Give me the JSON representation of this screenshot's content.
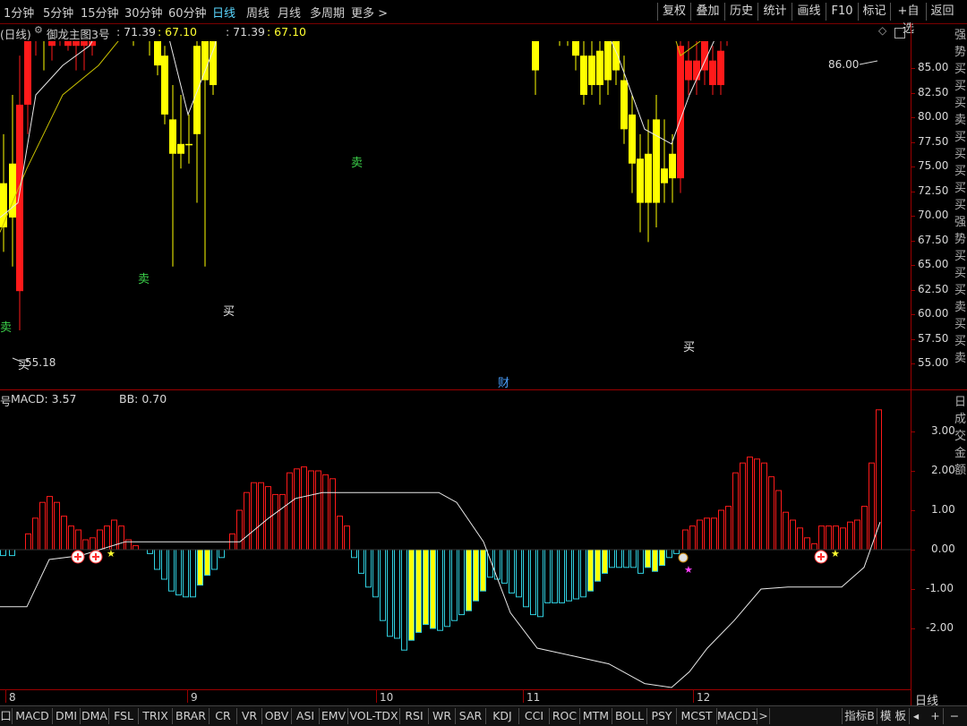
{
  "toolbar": {
    "periods": [
      "1分钟",
      "5分钟",
      "15分钟",
      "30分钟",
      "60分钟",
      "日线",
      "周线",
      "月线",
      "多周期",
      "更多 >"
    ],
    "active_period": "日线",
    "right_buttons": [
      "复权",
      "叠加",
      "历史",
      "统计",
      "画线",
      "F10",
      "标记",
      "+自选",
      "返回"
    ]
  },
  "main_info": {
    "period": "(日线)",
    "indicator": "御龙主图3号",
    "v1": ": 71.39",
    "v2": ": 67.10",
    "v3": ": 71.39",
    "v4": ": 67.10"
  },
  "main_chart": {
    "y_ticks": [
      "85.00",
      "82.50",
      "80.00",
      "77.50",
      "75.00",
      "72.50",
      "70.00",
      "67.50",
      "65.00",
      "62.50",
      "60.00",
      "57.50",
      "55.00"
    ],
    "max_label": "86.00",
    "min_label": "55.18",
    "buy_label": "买",
    "sell_label": "卖",
    "event_label": "财"
  },
  "sub_info": {
    "prefix": "号",
    "macd_label": "MACD: 3.57",
    "bb_label": "BB: 0.70"
  },
  "sub_chart": {
    "y_ticks": [
      "3.00",
      "2.00",
      "1.00",
      "0.00",
      "-1.00",
      "-2.00"
    ]
  },
  "dates": [
    "8",
    "9",
    "10",
    "11",
    "12"
  ],
  "right_column_text": "强势买买买卖买买买买买强势买买买卖买买卖",
  "right_column_sub": "日成交金额",
  "bottom_tabs": [
    "口",
    "MACD",
    "DMI",
    "DMA",
    "FSL",
    "TRIX",
    "BRAR",
    "CR",
    "VR",
    "OBV",
    "ASI",
    "EMV",
    "VOL-TDX",
    "RSI",
    "WR",
    "SAR",
    "KDJ",
    "CCI",
    "ROC",
    "MTM",
    "BOLL",
    "PSY",
    "MCST",
    "MACD1",
    ">"
  ],
  "bottom_right": [
    "指标B",
    "模 板"
  ],
  "corner_label": "日线",
  "colors": {
    "up": "#ff1a1a",
    "down": "#ffff00",
    "hist_neg": "#30d0e0",
    "axis": "#9a0000",
    "highlight": "#ffff00"
  }
}
